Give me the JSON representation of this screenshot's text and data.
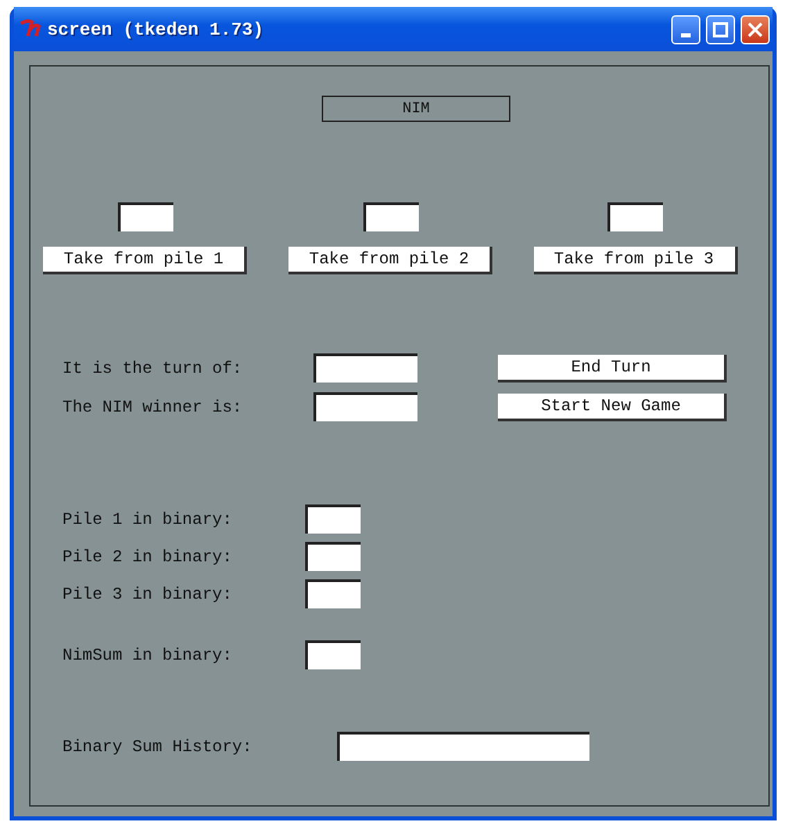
{
  "window": {
    "title": "screen (tkeden 1.73)"
  },
  "heading": "NIM",
  "piles": [
    {
      "button": "Take from pile 1"
    },
    {
      "button": "Take from pile 2"
    },
    {
      "button": "Take from pile 3"
    }
  ],
  "status_rows": [
    {
      "label": "It is the turn of:",
      "button": "End Turn"
    },
    {
      "label": "The NIM winner is:",
      "button": "Start New Game"
    }
  ],
  "binary_rows": [
    {
      "label": "Pile 1 in binary:"
    },
    {
      "label": "Pile 2 in binary:"
    },
    {
      "label": "Pile 3 in binary:"
    }
  ],
  "nimsum": {
    "label": "NimSum in binary:"
  },
  "history": {
    "label": "Binary Sum History:"
  }
}
